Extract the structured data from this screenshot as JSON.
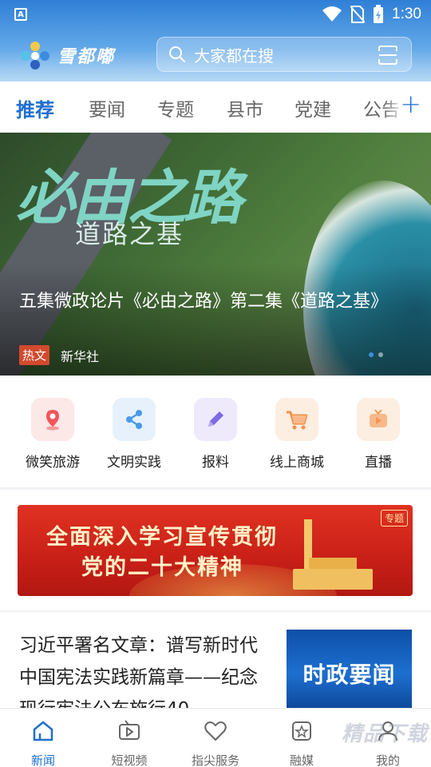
{
  "status_bar": {
    "time": "1:30",
    "left_icon": "A"
  },
  "header": {
    "app_name": "雪都嘟",
    "search_placeholder": "大家都在搜"
  },
  "tabs": {
    "items": [
      "推荐",
      "要闻",
      "专题",
      "县市",
      "党建",
      "公告"
    ],
    "active_index": 0,
    "add_label": "+"
  },
  "banner": {
    "calligraphy": "必由之路",
    "subtitle": "道路之基",
    "title": "五集微政论片《必由之路》第二集《道路之基》",
    "tag": "热文",
    "source": "新华社"
  },
  "quick_entries": [
    {
      "label": "微笑旅游",
      "icon": "location-pin-icon",
      "color": "#f2545b",
      "bg": "#fde8e8"
    },
    {
      "label": "文明实践",
      "icon": "share-icon",
      "color": "#4a9ae8",
      "bg": "#e6f1fc"
    },
    {
      "label": "报料",
      "icon": "pencil-icon",
      "color": "#7d6ae6",
      "bg": "#eeeafc"
    },
    {
      "label": "线上商城",
      "icon": "shopping-cart-icon",
      "color": "#f2924a",
      "bg": "#fdeee2"
    },
    {
      "label": "直播",
      "icon": "live-tv-icon",
      "color": "#f5964f",
      "bg": "#fdeee2"
    }
  ],
  "promo": {
    "line1": "全面深入学习宣传贯彻",
    "line2": "党的二十大精神",
    "tag": "专题"
  },
  "news": {
    "title": "习近平署名文章：谱写新时代中国宪法实践新篇章——纪念现行宪法公布施行40",
    "thumb_text": "时政要闻"
  },
  "bottom_nav": {
    "items": [
      {
        "label": "新闻",
        "icon": "home-icon"
      },
      {
        "label": "短视频",
        "icon": "video-icon"
      },
      {
        "label": "指尖服务",
        "icon": "heart-icon"
      },
      {
        "label": "融媒",
        "icon": "media-icon"
      },
      {
        "label": "我的",
        "icon": "profile-icon"
      }
    ],
    "active_index": 0
  },
  "watermark": "精品下载",
  "colors": {
    "accent": "#1f6fd1",
    "header": "#2f7fd6",
    "promo_red": "#d42a1e"
  }
}
